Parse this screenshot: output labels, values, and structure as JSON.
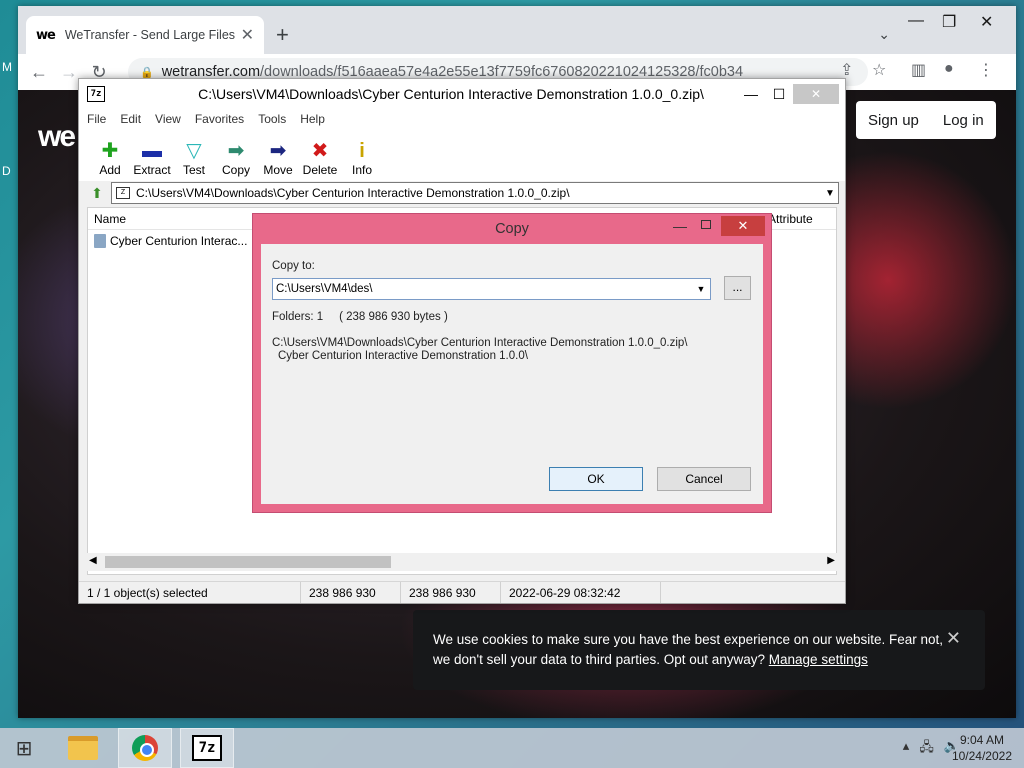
{
  "browser": {
    "tab_title": "WeTransfer - Send Large Files &",
    "tab_favicon": "we",
    "url_host": "wetransfer.com",
    "url_path": "/downloads/f516aaea57e4a2e55e13f7759fc6760820221024125328/fc0b34"
  },
  "page": {
    "logo": "we",
    "signup_label": "Sign up",
    "login_label": "Log in",
    "cookie_text_1": "We use cookies to make sure you have the best experience on our website. Fear not,",
    "cookie_text_2": "we don't sell your data to third parties. Opt out anyway?",
    "cookie_link": "Manage settings"
  },
  "sevenzip": {
    "title": "C:\\Users\\VM4\\Downloads\\Cyber Centurion Interactive Demonstration 1.0.0_0.zip\\",
    "icon_label": "7z",
    "menu": [
      "File",
      "Edit",
      "View",
      "Favorites",
      "Tools",
      "Help"
    ],
    "tools": [
      {
        "label": "Add",
        "icon": "add-icon"
      },
      {
        "label": "Extract",
        "icon": "extract-icon"
      },
      {
        "label": "Test",
        "icon": "test-icon"
      },
      {
        "label": "Copy",
        "icon": "copy-icon"
      },
      {
        "label": "Move",
        "icon": "move-icon"
      },
      {
        "label": "Delete",
        "icon": "delete-icon"
      },
      {
        "label": "Info",
        "icon": "info-icon"
      }
    ],
    "address": "C:\\Users\\VM4\\Downloads\\Cyber Centurion Interactive Demonstration 1.0.0_0.zip\\",
    "col_name": "Name",
    "col_attributes": "Attribute",
    "row_name": "Cyber Centurion Interac...",
    "status": {
      "selected": "1 / 1 object(s) selected",
      "size": "238 986 930",
      "packed": "238 986 930",
      "modified": "2022-06-29 08:32:42"
    }
  },
  "copy_dialog": {
    "title": "Copy",
    "copy_to_label": "Copy to:",
    "copy_to_value": "C:\\Users\\VM4\\des\\",
    "browse_label": "...",
    "folders_info": "Folders: 1     ( 238 986 930 bytes )",
    "path_line1": "C:\\Users\\VM4\\Downloads\\Cyber Centurion Interactive Demonstration 1.0.0_0.zip\\",
    "path_line2": "Cyber Centurion Interactive Demonstration 1.0.0\\",
    "ok_label": "OK",
    "cancel_label": "Cancel"
  },
  "taskbar": {
    "sevenzip_label": "7z",
    "time": "9:04 AM",
    "date": "10/24/2022"
  }
}
